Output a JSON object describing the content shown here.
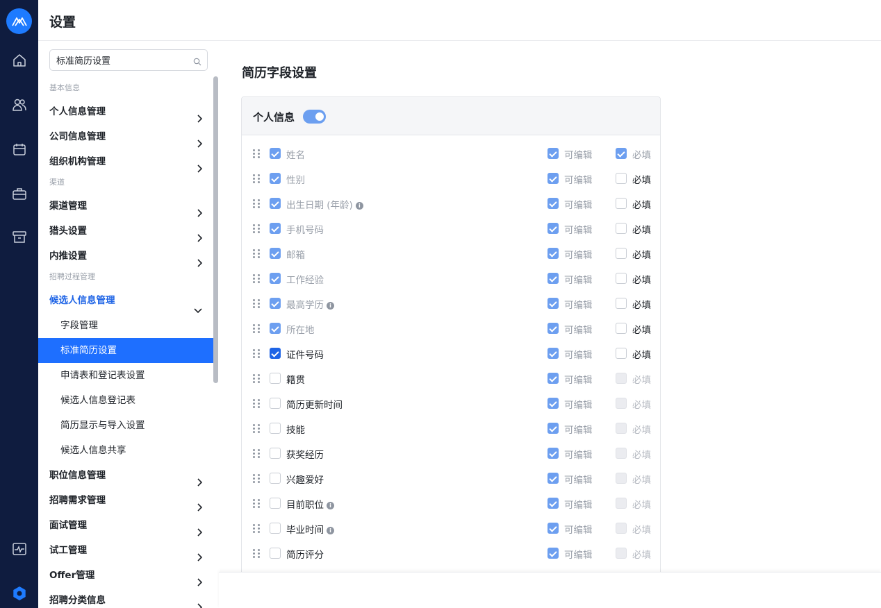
{
  "rail": {
    "icons": [
      "logo-icon",
      "home-icon",
      "people-icon",
      "calendar-icon",
      "briefcase-icon",
      "archive-icon",
      "activity-icon",
      "settings-gear-icon"
    ],
    "colors": {
      "background": "#0f1c3f",
      "accent": "#1e7bff"
    }
  },
  "header": {
    "title": "设置"
  },
  "sidebar": {
    "search": {
      "value": "标准简历设置",
      "placeholder": ""
    },
    "sections": {
      "basic": "基本信息",
      "channel": "渠道",
      "process": "招聘过程管理"
    },
    "items": {
      "personal": "个人信息管理",
      "company": "公司信息管理",
      "org": "组织机构管理",
      "channel": "渠道管理",
      "headhunter": "猎头设置",
      "referral": "内推设置",
      "candidate": "候选人信息管理",
      "position": "职位信息管理",
      "demand": "招聘需求管理",
      "interview": "面试管理",
      "trial": "试工管理",
      "offer": "Offer管理",
      "category": "招聘分类信息"
    },
    "sub_items": {
      "fields": "字段管理",
      "standard_resume": "标准简历设置",
      "application_form": "申请表和登记表设置",
      "candidate_register": "候选人信息登记表",
      "resume_display": "简历显示与导入设置",
      "candidate_share": "候选人信息共享"
    }
  },
  "main": {
    "title": "简历字段设置",
    "card": {
      "title": "个人信息",
      "toggle_on": true,
      "editable_label": "可编辑",
      "required_label": "必填",
      "fields": [
        {
          "name": "姓名",
          "checked": true,
          "locked": true,
          "info": false,
          "required": true,
          "required_disabled": false
        },
        {
          "name": "性别",
          "checked": true,
          "locked": true,
          "info": false,
          "required": false,
          "required_disabled": false
        },
        {
          "name": "出生日期 (年龄)",
          "checked": true,
          "locked": true,
          "info": true,
          "required": false,
          "required_disabled": false
        },
        {
          "name": "手机号码",
          "checked": true,
          "locked": true,
          "info": false,
          "required": false,
          "required_disabled": false
        },
        {
          "name": "邮箱",
          "checked": true,
          "locked": true,
          "info": false,
          "required": false,
          "required_disabled": false
        },
        {
          "name": "工作经验",
          "checked": true,
          "locked": true,
          "info": false,
          "required": false,
          "required_disabled": false
        },
        {
          "name": "最高学历",
          "checked": true,
          "locked": true,
          "info": true,
          "required": false,
          "required_disabled": false
        },
        {
          "name": "所在地",
          "checked": true,
          "locked": true,
          "info": false,
          "required": false,
          "required_disabled": false
        },
        {
          "name": "证件号码",
          "checked": true,
          "locked": false,
          "info": false,
          "required": false,
          "required_disabled": false
        },
        {
          "name": "籍贯",
          "checked": false,
          "locked": false,
          "info": false,
          "required": false,
          "required_disabled": true
        },
        {
          "name": "简历更新时间",
          "checked": false,
          "locked": false,
          "info": false,
          "required": false,
          "required_disabled": true
        },
        {
          "name": "技能",
          "checked": false,
          "locked": false,
          "info": false,
          "required": false,
          "required_disabled": true
        },
        {
          "name": "获奖经历",
          "checked": false,
          "locked": false,
          "info": false,
          "required": false,
          "required_disabled": true
        },
        {
          "name": "兴趣爱好",
          "checked": false,
          "locked": false,
          "info": false,
          "required": false,
          "required_disabled": true
        },
        {
          "name": "目前职位",
          "checked": false,
          "locked": false,
          "info": true,
          "required": false,
          "required_disabled": true
        },
        {
          "name": "毕业时间",
          "checked": false,
          "locked": false,
          "info": true,
          "required": false,
          "required_disabled": true
        },
        {
          "name": "简历评分",
          "checked": false,
          "locked": false,
          "info": false,
          "required": false,
          "required_disabled": true
        }
      ]
    }
  }
}
